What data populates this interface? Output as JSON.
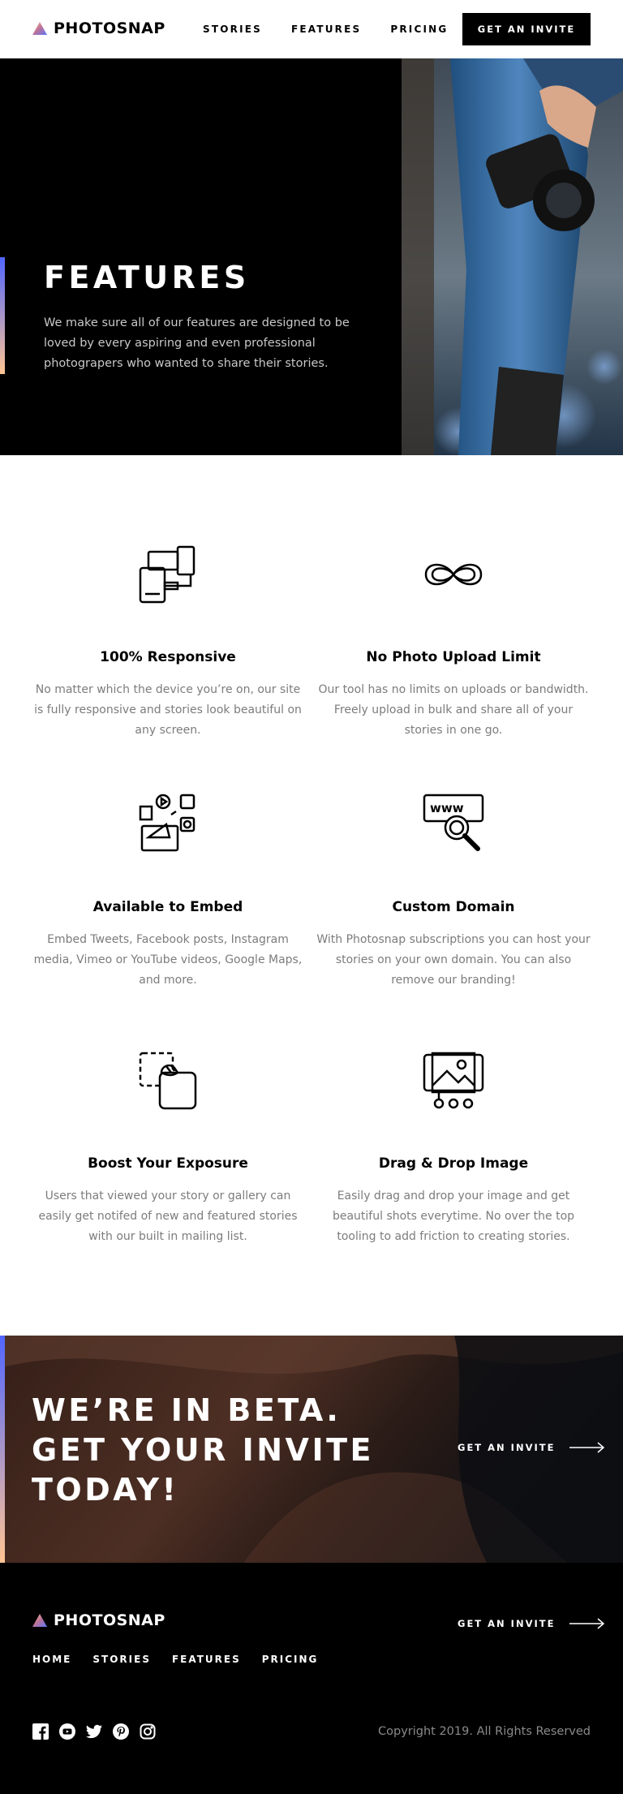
{
  "header": {
    "logo_text": "PHOTOSNAP",
    "nav": [
      "STORIES",
      "FEATURES",
      "PRICING"
    ],
    "cta": "GET AN INVITE"
  },
  "hero": {
    "title": "FEATURES",
    "text": "We make sure all of our features are designed to be loved by every aspiring and even professional photograpers who wanted to share their stories."
  },
  "features": [
    {
      "icon": "responsive-devices-icon",
      "title": "100% Responsive",
      "text": "No matter which the device you’re on, our site is fully responsive and stories look beautiful on any screen."
    },
    {
      "icon": "infinity-icon",
      "title": "No Photo Upload Limit",
      "text": "Our tool has no limits on uploads or bandwidth. Freely upload in bulk and share all of your stories in one go."
    },
    {
      "icon": "embed-media-icon",
      "title": "Available to Embed",
      "text": "Embed Tweets, Facebook posts, Instagram media, Vimeo or YouTube videos, Google Maps, and more."
    },
    {
      "icon": "custom-domain-icon",
      "title": "Custom Domain",
      "text": "With Photosnap subscriptions you can host your stories on your own domain. You can also remove our branding!"
    },
    {
      "icon": "boost-exposure-icon",
      "title": "Boost Your Exposure",
      "text": "Users that viewed your story or gallery can easily get notifed of new and featured stories with our built in mailing list."
    },
    {
      "icon": "drag-drop-image-icon",
      "title": "Drag & Drop Image",
      "text": "Easily drag and drop your image and get beautiful shots everytime. No over the top tooling to add friction to creating stories."
    }
  ],
  "beta": {
    "line1": "WE’RE IN BETA.",
    "line2": "GET YOUR INVITE",
    "line3": "TODAY!",
    "cta": "GET AN INVITE"
  },
  "footer": {
    "logo_text": "PHOTOSNAP",
    "nav": [
      "HOME",
      "STORIES",
      "FEATURES",
      "PRICING"
    ],
    "cta": "GET AN INVITE",
    "socials": [
      "facebook-icon",
      "youtube-icon",
      "twitter-icon",
      "pinterest-icon",
      "instagram-icon"
    ],
    "copyright": "Copyright 2019. All Rights Reserved"
  },
  "colors": {
    "gradient_start": "#5165ff",
    "gradient_mid": "#bfa6e2",
    "gradient_end": "#ffc593",
    "text_muted": "#7c7c7c"
  }
}
